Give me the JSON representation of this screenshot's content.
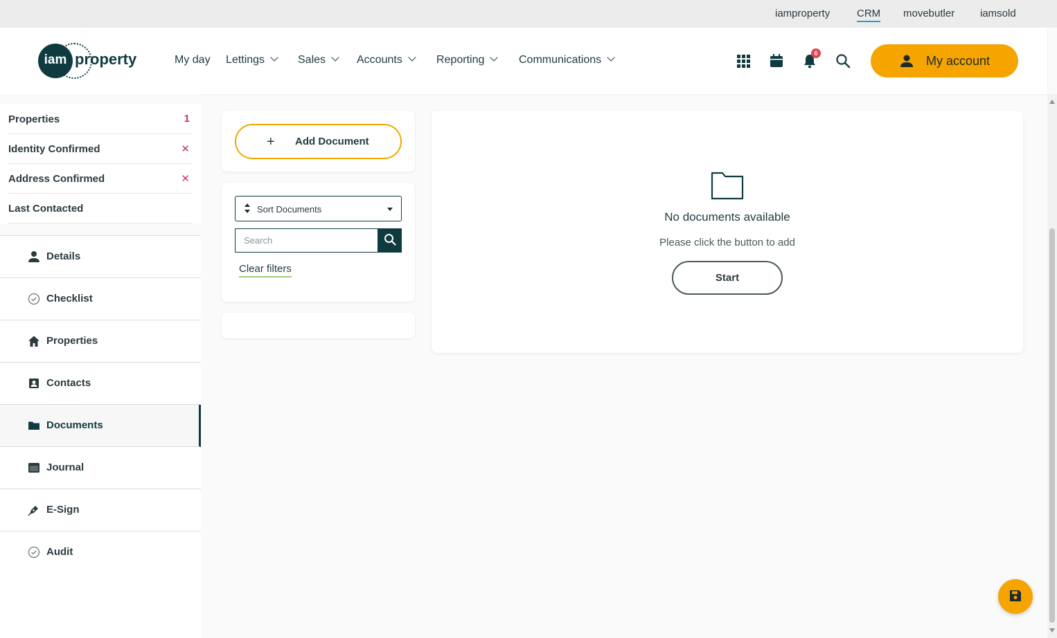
{
  "brand_links": [
    "iamproperty",
    "CRM",
    "movebutler",
    "iamsold"
  ],
  "logo": {
    "mark": "iam",
    "word": "property"
  },
  "nav": [
    "My day",
    "Lettings",
    "Sales",
    "Accounts",
    "Reporting",
    "Communications"
  ],
  "notifications": {
    "count": "6"
  },
  "account": {
    "label": "My account"
  },
  "summary": [
    {
      "label": "Properties",
      "value": "1"
    },
    {
      "label": "Identity Confirmed",
      "value": "✕"
    },
    {
      "label": "Address Confirmed",
      "value": "✕"
    },
    {
      "label": "Last Contacted",
      "value": ""
    }
  ],
  "menu": [
    {
      "label": "Details",
      "icon": "person-icon"
    },
    {
      "label": "Checklist",
      "icon": "check-circle-icon"
    },
    {
      "label": "Properties",
      "icon": "home-icon"
    },
    {
      "label": "Contacts",
      "icon": "contact-card-icon"
    },
    {
      "label": "Documents",
      "icon": "folder-icon",
      "active": true
    },
    {
      "label": "Journal",
      "icon": "journal-icon"
    },
    {
      "label": "E-Sign",
      "icon": "pen-icon"
    },
    {
      "label": "Audit",
      "icon": "check-circle-icon"
    }
  ],
  "documents": {
    "add_label": "Add Document",
    "sort_label": "Sort Documents",
    "search_placeholder": "Search",
    "clear_filters": "Clear filters",
    "empty_title": "No documents available",
    "empty_sub": "Please click the button to add",
    "start_label": "Start"
  },
  "colors": {
    "accent": "#f5a400",
    "brand_dark": "#0f3b40",
    "alert": "#d0307a"
  }
}
